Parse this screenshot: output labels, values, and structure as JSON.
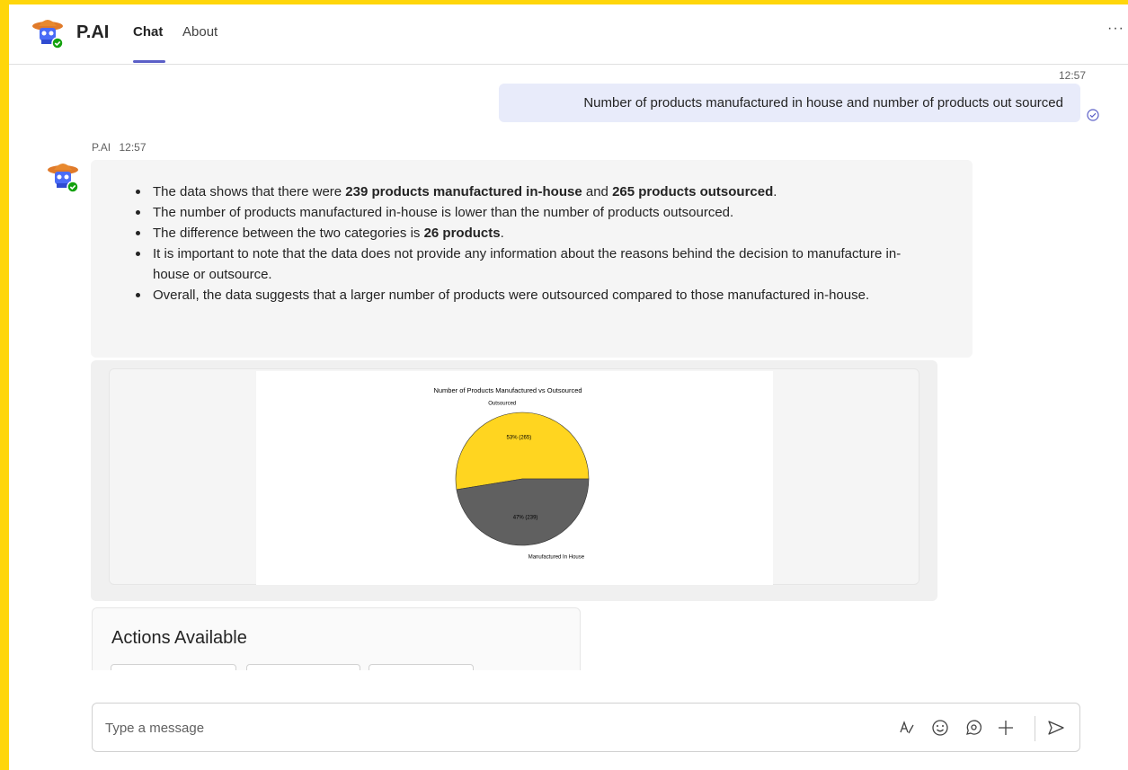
{
  "header": {
    "app_name": "P.AI",
    "tabs": [
      {
        "label": "Chat",
        "active": true
      },
      {
        "label": "About",
        "active": false
      }
    ],
    "more_label": "···"
  },
  "messages": {
    "sent": {
      "time": "12:57",
      "text": "Number of products manufactured in house and number of products out sourced"
    },
    "bot": {
      "sender": "P.AI",
      "time": "12:57",
      "bullets": [
        {
          "parts": [
            {
              "text": "The data shows that there were ",
              "bold": false
            },
            {
              "text": "239 products manufactured in-house",
              "bold": true
            },
            {
              "text": " and ",
              "bold": false
            },
            {
              "text": "265 products outsourced",
              "bold": true
            },
            {
              "text": ".",
              "bold": false
            }
          ]
        },
        {
          "parts": [
            {
              "text": "The number of products manufactured in-house is lower than the number of products outsourced.",
              "bold": false
            }
          ]
        },
        {
          "parts": [
            {
              "text": "The difference between the two categories is ",
              "bold": false
            },
            {
              "text": "26 products",
              "bold": true
            },
            {
              "text": ".",
              "bold": false
            }
          ]
        },
        {
          "parts": [
            {
              "text": "It is important to note that the data does not provide any information about the reasons behind the decision to manufacture in-house or outsource.",
              "bold": false
            }
          ]
        },
        {
          "parts": [
            {
              "text": "Overall, the data suggests that a larger number of products were outsourced compared to those manufactured in-house.",
              "bold": false
            }
          ]
        }
      ]
    }
  },
  "chart_data": {
    "type": "pie",
    "title": "Number of Products Manufactured vs Outsourced",
    "slices": [
      {
        "label": "Outsourced",
        "value": 265,
        "percent_label": "53% (265)",
        "color": "#ffd520"
      },
      {
        "label": "Manufactured In House",
        "value": 239,
        "percent_label": "47% (239)",
        "color": "#606060"
      }
    ],
    "legend": "none"
  },
  "actions": {
    "title": "Actions Available",
    "button_count_visible": 3
  },
  "composer": {
    "placeholder": "Type a message"
  },
  "colors": {
    "frame": "#ffd60a",
    "accent": "#5b5fc7",
    "sent_bubble": "#e8ebfa",
    "bot_bubble": "#f5f5f5"
  },
  "icons": {
    "format": "format-icon",
    "emoji": "emoji-icon",
    "loop": "loop-icon",
    "attach": "plus-icon",
    "send": "send-icon",
    "read": "read-receipt-icon"
  }
}
